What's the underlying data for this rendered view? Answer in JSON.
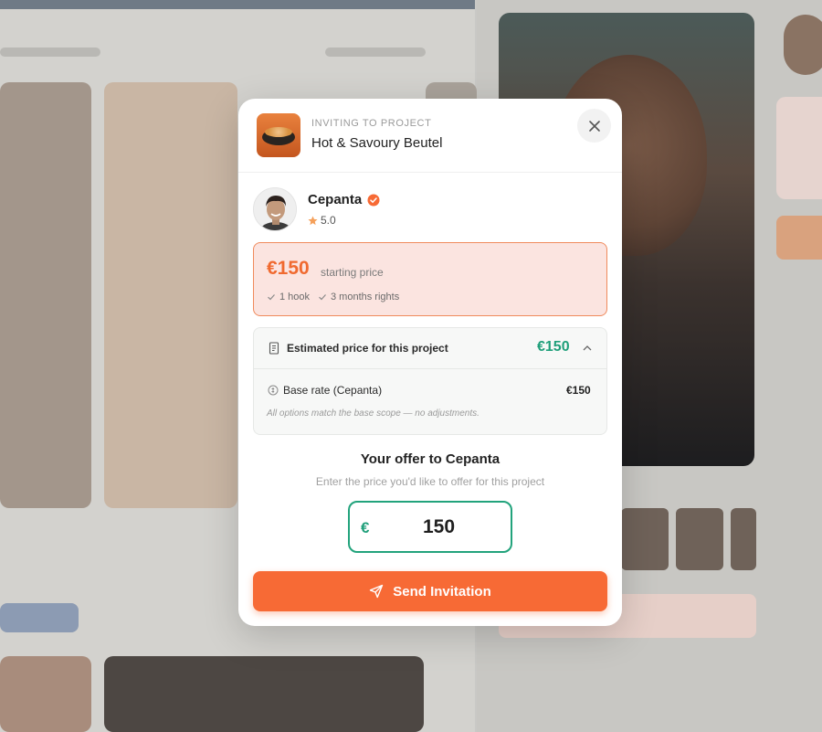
{
  "modal": {
    "project": {
      "eyebrow": "INVITING TO PROJECT",
      "name": "Hot & Savoury Beutel",
      "thumbnail_icon": "food-bowl-image"
    },
    "close_icon": "close-icon",
    "creator": {
      "name": "Cepanta",
      "verified_icon": "verified-badge-icon",
      "rating": "5.0",
      "rating_icon": "star-icon"
    },
    "price_card": {
      "price": "€150",
      "price_label": "starting price",
      "features": [
        "1 hook",
        "3 months rights"
      ],
      "feature_icon": "check-icon"
    },
    "estimate": {
      "label": "Estimated price for this project",
      "total": "€150",
      "label_icon": "receipt-icon",
      "toggle_icon": "chevron-up-icon",
      "base_rate_label": "Base rate (Cepanta)",
      "base_rate_icon": "coin-icon",
      "base_rate_value": "€150",
      "note": "All options match the base scope — no adjustments."
    },
    "offer": {
      "title": "Your offer to Cepanta",
      "subtitle": "Enter the price you'd like to offer for this project",
      "currency": "€",
      "value": "150"
    },
    "send_button": {
      "label": "Send Invitation",
      "icon": "send-icon"
    }
  },
  "colors": {
    "accent_orange": "#f76a35",
    "price_orange": "#f06a30",
    "price_card_bg": "#fbe4e0",
    "success_green": "#1f9f7a",
    "input_border": "#22a37c",
    "star": "#f5a05a"
  }
}
